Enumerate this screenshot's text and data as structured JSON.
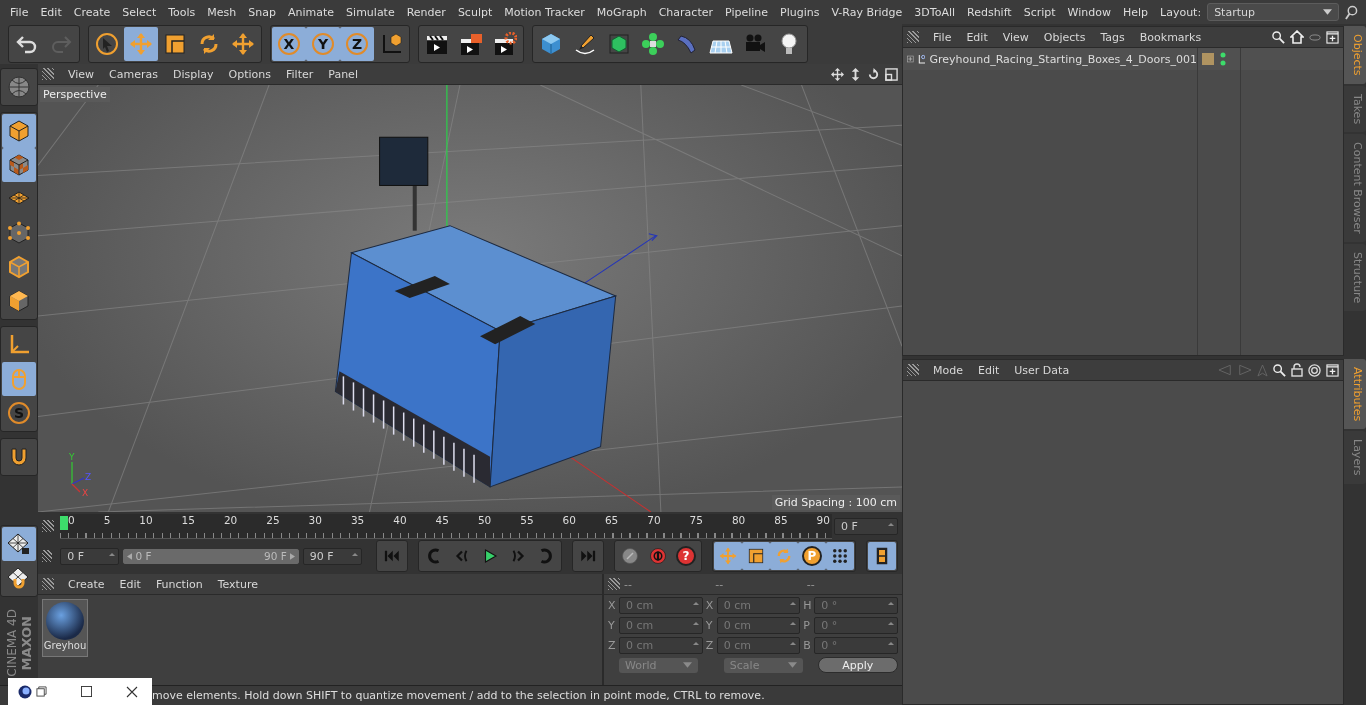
{
  "menubar": {
    "items": [
      "File",
      "Edit",
      "Create",
      "Select",
      "Tools",
      "Mesh",
      "Snap",
      "Animate",
      "Simulate",
      "Render",
      "Sculpt",
      "Motion Tracker",
      "MoGraph",
      "Character",
      "Pipeline",
      "Plugins",
      "V-Ray Bridge",
      "3DToAll",
      "Redshift",
      "Script",
      "Window",
      "Help"
    ],
    "layout_label": "Layout:",
    "layout_value": "Startup"
  },
  "toolbar": [
    [
      {
        "kind": "undo",
        "selected": false,
        "disabled": false
      },
      {
        "kind": "redo",
        "selected": false,
        "disabled": true
      }
    ],
    [
      {
        "kind": "cursor",
        "selected": false,
        "disabled": false
      },
      {
        "kind": "move",
        "selected": true,
        "disabled": false
      },
      {
        "kind": "scale",
        "selected": false,
        "disabled": false
      },
      {
        "kind": "rotate",
        "selected": false,
        "disabled": false
      },
      {
        "kind": "move",
        "selected": false,
        "disabled": false
      }
    ],
    [
      {
        "kind": "letter",
        "label": "X",
        "selected": true,
        "disabled": false
      },
      {
        "kind": "letter",
        "label": "Y",
        "selected": true,
        "disabled": false
      },
      {
        "kind": "letter",
        "label": "Z",
        "selected": true,
        "disabled": false
      },
      {
        "kind": "coord",
        "selected": false,
        "disabled": false
      }
    ],
    [
      {
        "kind": "clapper",
        "selected": false,
        "disabled": false
      },
      {
        "kind": "clapper-pic",
        "selected": false,
        "disabled": false
      },
      {
        "kind": "clapper-gear",
        "selected": false,
        "disabled": false
      }
    ],
    [
      {
        "kind": "cube",
        "selected": false,
        "disabled": false
      },
      {
        "kind": "pen",
        "selected": false,
        "disabled": false
      },
      {
        "kind": "green-cube",
        "selected": false,
        "disabled": false
      },
      {
        "kind": "cloner",
        "selected": false,
        "disabled": false
      },
      {
        "kind": "bend",
        "selected": false,
        "disabled": false
      },
      {
        "kind": "floor",
        "selected": false,
        "disabled": false
      },
      {
        "kind": "camera",
        "selected": false,
        "disabled": false
      },
      {
        "kind": "bulb",
        "selected": false,
        "disabled": false
      }
    ]
  ],
  "left_tools": [
    [
      {
        "kind": "globe",
        "selected": false
      }
    ],
    [
      {
        "kind": "model-cube",
        "selected": true
      },
      {
        "kind": "checker-cube",
        "selected": true
      },
      {
        "kind": "grid-plane",
        "selected": false
      },
      {
        "kind": "point-cube",
        "selected": false
      },
      {
        "kind": "edge-cube",
        "selected": false
      },
      {
        "kind": "polygon-cube",
        "selected": false
      }
    ],
    [
      {
        "kind": "axis-corner",
        "selected": false
      },
      {
        "kind": "mouse",
        "selected": true
      },
      {
        "kind": "letter",
        "label": "S",
        "selected": false
      }
    ],
    [
      {
        "kind": "magnet",
        "selected": false
      }
    ]
  ],
  "left_bottom_tools": [
    {
      "kind": "grid-lock",
      "selected": true
    },
    {
      "kind": "grid-snap",
      "selected": false
    }
  ],
  "brand": {
    "maker": "MAXON",
    "product": "CINEMA 4D"
  },
  "viewport": {
    "menu": [
      "View",
      "Cameras",
      "Display",
      "Options",
      "Filter",
      "Panel"
    ],
    "camera": "Perspective",
    "grid_spacing": "Grid Spacing : 100 cm",
    "gizmo": {
      "y": "Y",
      "z": "Z",
      "x": "X"
    }
  },
  "timeline": {
    "ticks": [
      "0",
      "5",
      "10",
      "15",
      "20",
      "25",
      "30",
      "35",
      "40",
      "45",
      "50",
      "55",
      "60",
      "65",
      "70",
      "75",
      "80",
      "85",
      "90"
    ],
    "playhead": {
      "level": 0
    },
    "current_frame": "0 F"
  },
  "transport": {
    "start": "0 F",
    "range": {
      "start": "0 F",
      "end": "90 F",
      "level": 1
    },
    "end": "90 F",
    "buttons": [
      [
        {
          "kind": "skip-start",
          "selected": false
        }
      ],
      [
        {
          "kind": "prev-key",
          "selected": false
        },
        {
          "kind": "step-back",
          "selected": false
        },
        {
          "kind": "play",
          "selected": false
        },
        {
          "kind": "step-forward",
          "selected": false
        },
        {
          "kind": "next-key",
          "selected": false
        }
      ],
      [
        {
          "kind": "skip-end",
          "selected": false
        }
      ],
      [
        {
          "kind": "record",
          "selected": false
        },
        {
          "kind": "autokey",
          "selected": false
        },
        {
          "kind": "help",
          "label": "?",
          "selected": false
        }
      ],
      [
        {
          "kind": "move",
          "selected": true
        },
        {
          "kind": "scale",
          "selected": true
        },
        {
          "kind": "rotate",
          "selected": true
        },
        {
          "kind": "param",
          "label": "P",
          "selected": true
        },
        {
          "kind": "dots",
          "selected": true
        }
      ],
      [
        {
          "kind": "film",
          "selected": true
        }
      ]
    ]
  },
  "materials": {
    "menu": [
      "Create",
      "Edit",
      "Function",
      "Texture"
    ],
    "items": [
      {
        "name": "Greyhou"
      }
    ]
  },
  "coordinates": {
    "headers": [
      "--",
      "--",
      "--"
    ],
    "rows": [
      {
        "a": "X",
        "a_value": "0 cm",
        "b": "X",
        "b_value": "0 cm",
        "c": "H",
        "c_value": "0 °"
      },
      {
        "a": "Y",
        "a_value": "0 cm",
        "b": "Y",
        "b_value": "0 cm",
        "c": "P",
        "c_value": "0 °"
      },
      {
        "a": "Z",
        "a_value": "0 cm",
        "b": "Z",
        "b_value": "0 cm",
        "c": "B",
        "c_value": "0 °"
      }
    ],
    "space": "World",
    "mode": "Scale",
    "apply": "Apply"
  },
  "status_bar": "move elements. Hold down SHIFT to quantize movement / add to the selection in point mode, CTRL to remove.",
  "objects": {
    "menu": [
      "File",
      "Edit",
      "View",
      "Objects",
      "Tags",
      "Bookmarks"
    ],
    "items": [
      {
        "name": "Greyhound_Racing_Starting_Boxes_4_Doors_001",
        "expanded": false,
        "color": "#b09461",
        "editor_visible": true,
        "render_visible": true
      }
    ]
  },
  "attributes": {
    "menu": [
      "Mode",
      "Edit",
      "User Data"
    ]
  },
  "side_tabs_top": [
    {
      "label": "Objects",
      "selected": true
    },
    {
      "label": "Takes",
      "selected": false
    },
    {
      "label": "Content Browser",
      "selected": false
    },
    {
      "label": "Structure",
      "selected": false
    }
  ],
  "side_tabs_bottom": [
    {
      "label": "Attributes",
      "selected": true
    },
    {
      "label": "Layers",
      "selected": false
    }
  ]
}
